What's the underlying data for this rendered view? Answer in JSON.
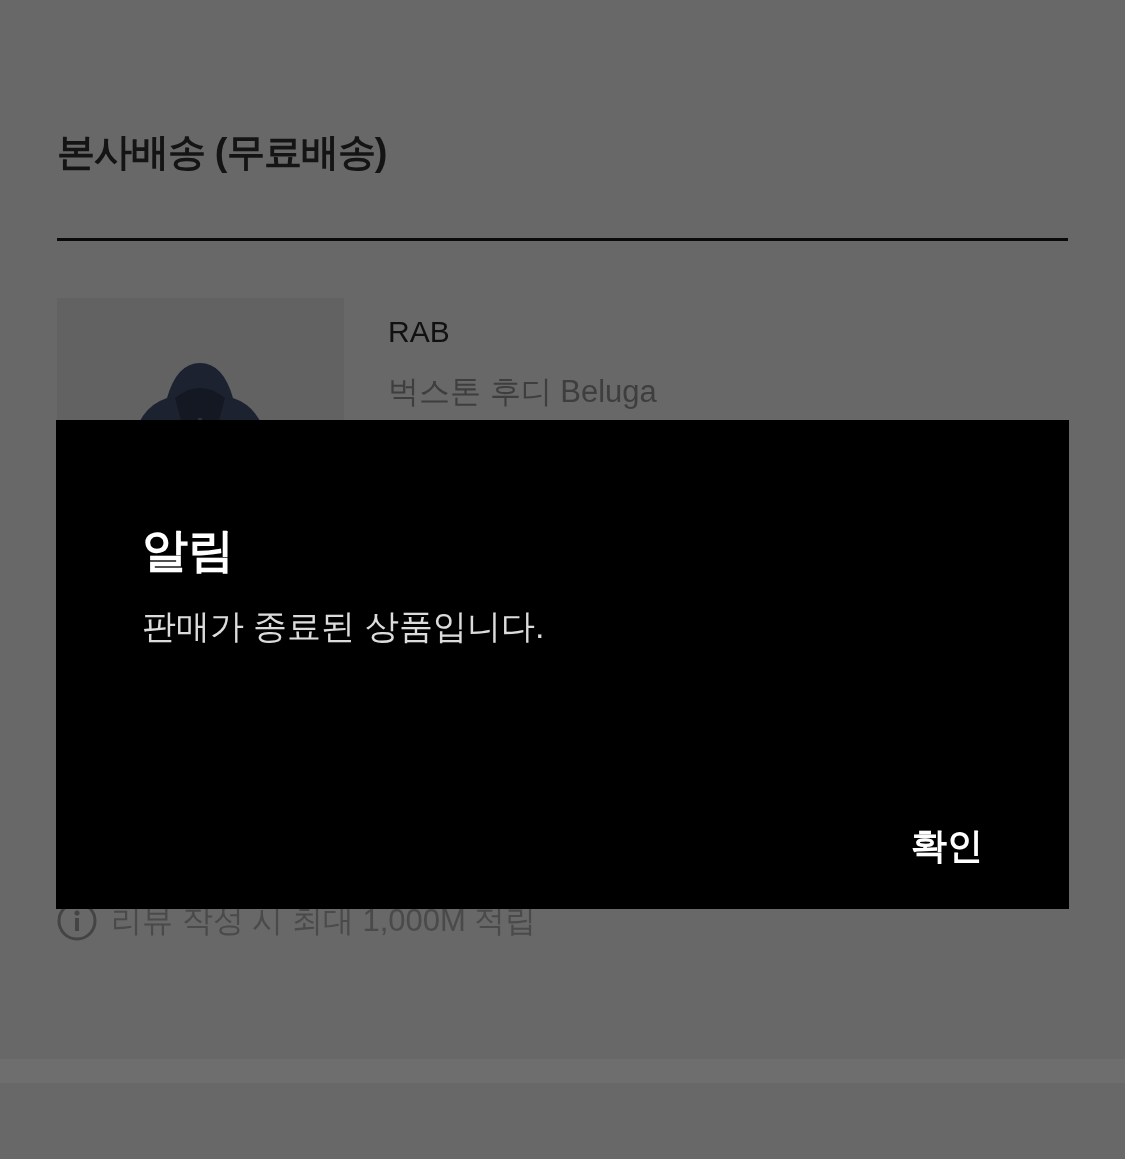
{
  "section_title": "본사배송 (무료배송)",
  "product": {
    "brand": "RAB",
    "name": "벅스톤 후디 Beluga"
  },
  "review_note": "리뷰 작성 시 최대 1,000M 적립",
  "dialog": {
    "title": "알림",
    "message": "판매가 종료된 상품입니다.",
    "confirm_button": "확인"
  }
}
